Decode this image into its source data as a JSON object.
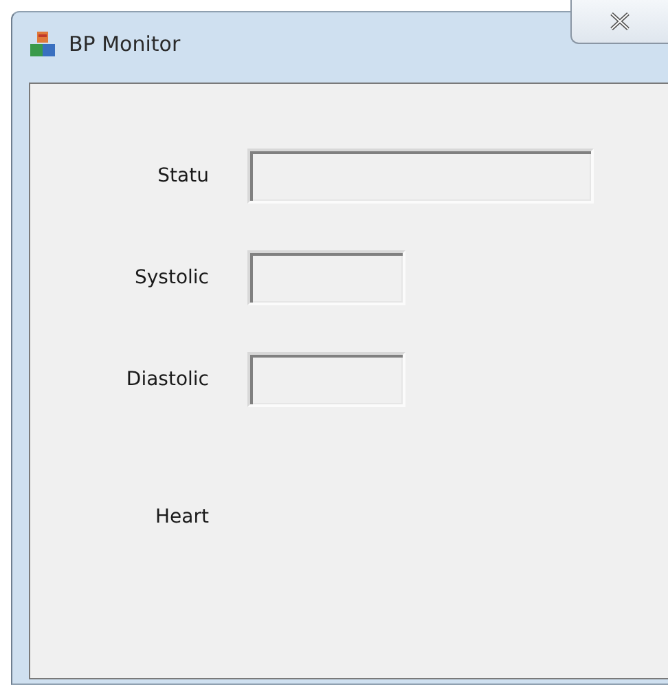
{
  "window": {
    "title": "BP Monitor"
  },
  "rows": [
    {
      "label": "Statu",
      "kind": "wide-field"
    },
    {
      "label": "Systolic",
      "kind": "short-field"
    },
    {
      "label": "Diastolic",
      "kind": "short-field"
    },
    {
      "label": "Heart",
      "kind": "label-only"
    }
  ]
}
